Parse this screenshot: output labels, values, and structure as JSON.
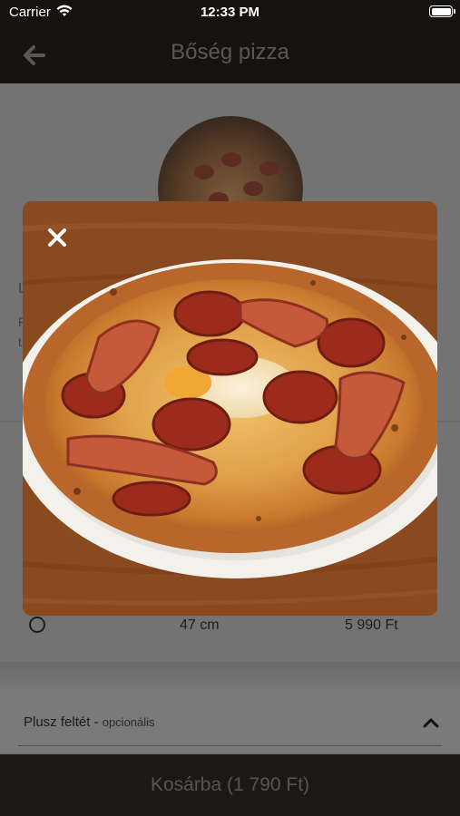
{
  "status_bar": {
    "carrier": "Carrier",
    "time": "12:33 PM"
  },
  "nav": {
    "title": "Bőség pizza",
    "back_icon": "arrow-left-icon"
  },
  "background": {
    "side_text_a": "L",
    "side_text_b_line1": "P",
    "side_text_b_line2": "t"
  },
  "modal": {
    "close_icon": "close-icon",
    "image_alt": "pizza-photo"
  },
  "size_option": {
    "size": "47 cm",
    "price": "5 990 Ft",
    "selected": false
  },
  "extras": {
    "label": "Plusz feltét",
    "optional": "opcionális",
    "chevron_icon": "chevron-up-icon"
  },
  "cart": {
    "label": "Kosárba (1 790 Ft)"
  },
  "colors": {
    "dark_bar": "#15120f",
    "overlay": "#737373",
    "title_text": "#5c5752"
  }
}
